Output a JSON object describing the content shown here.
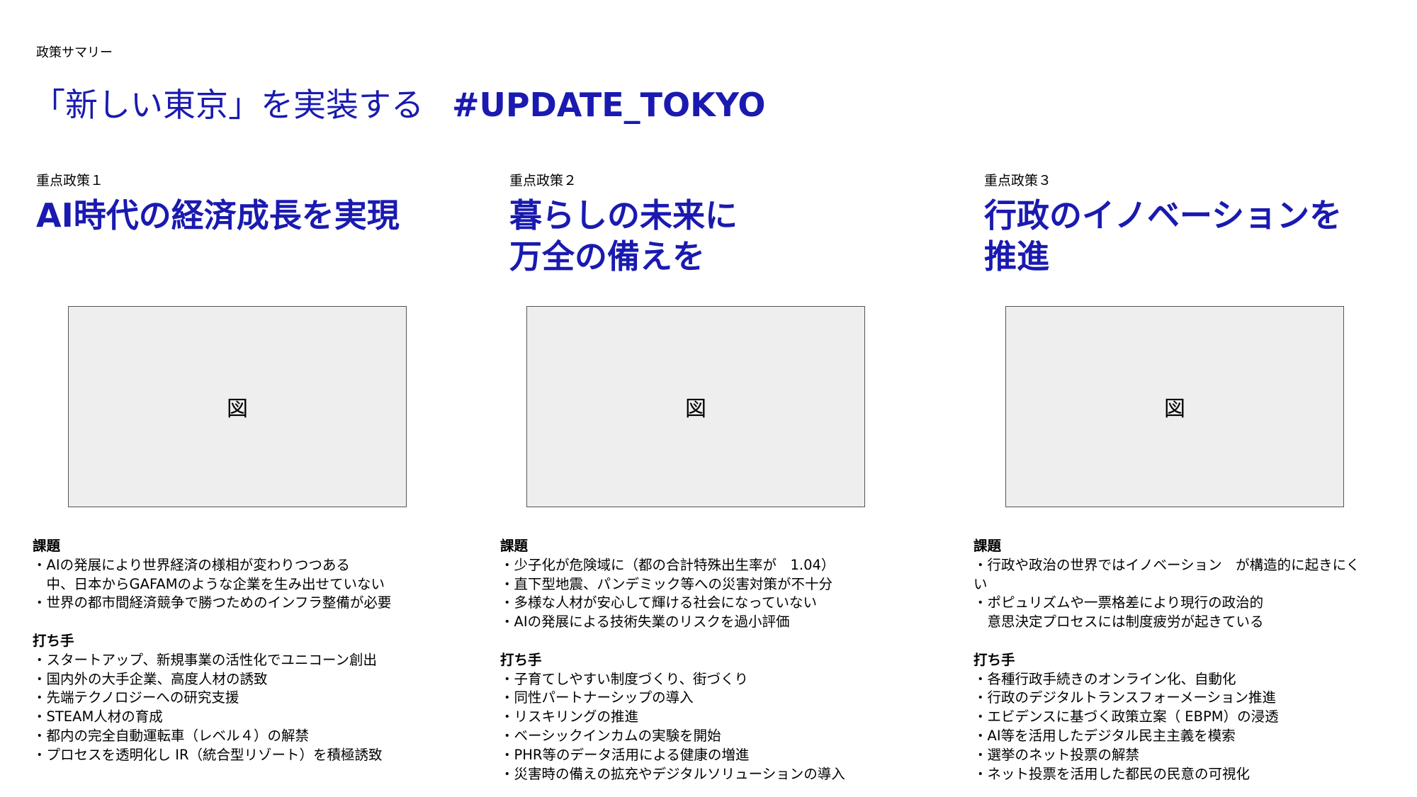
{
  "header": {
    "subtitle": "政策サマリー",
    "title": "「新しい東京」を実装する",
    "hashtag": "#UPDATE_TOKYO",
    "title_color": "#1a1ab0"
  },
  "figure_label": "図",
  "policies": [
    {
      "label": "重点政策１",
      "heading_lines": [
        "AI時代の経済成長を実現"
      ],
      "heading_strong": "AI",
      "heading_rest": "時代の経済成長を実現",
      "issues_title": "課題",
      "issues": [
        "・AIの発展により世界経済の様相が変わりつつある",
        "　中、日本からGAFAMのような企業を生み出せていない",
        "・世界の都市間経済競争で勝つためのインフラ整備が必要"
      ],
      "measures_title": "打ち手",
      "measures": [
        "・スタートアップ、新規事業の活性化でユニコーン創出",
        "・国内外の大手企業、高度人材の誘致",
        "・先端テクノロジーへの研究支援",
        "・STEAM人材の育成",
        "・都内の完全自動運転車（レベル４）の解禁",
        "・プロセスを透明化し IR（統合型リゾート）を積極誘致"
      ]
    },
    {
      "label": "重点政策２",
      "heading_lines": [
        "暮らしの未来に",
        "万全の備えを"
      ],
      "issues_title": "課題",
      "issues": [
        "・少子化が危険域に（都の合計特殊出生率が　1.04）",
        "・直下型地震、パンデミック等への災害対策が不十分",
        "・多様な人材が安心して輝ける社会になっていない",
        "・AIの発展による技術失業のリスクを過小評価"
      ],
      "measures_title": "打ち手",
      "measures": [
        "・子育てしやすい制度づくり、街づくり",
        "・同性パートナーシップの導入",
        "・リスキリングの推進",
        "・ベーシックインカムの実験を開始",
        "・PHR等のデータ活用による健康の増進",
        "・災害時の備えの拡充やデジタルソリューションの導入"
      ]
    },
    {
      "label": "重点政策３",
      "heading_lines": [
        "行政のイノベーションを",
        "推進"
      ],
      "issues_title": "課題",
      "issues": [
        "・行政や政治の世界ではイノベーション　が構造的に起きにく",
        "い",
        "・ポピュリズムや一票格差により現行の政治的",
        "　意思決定プロセスには制度疲労が起きている"
      ],
      "measures_title": "打ち手",
      "measures": [
        "・各種行政手続きのオンライン化、自動化",
        "・行政のデジタルトランスフォーメーション推進",
        "・エビデンスに基づく政策立案（ EBPM）の浸透",
        "・AI等を活用したデジタル民主主義を模索",
        "・選挙のネット投票の解禁",
        "・ネット投票を活用した都民の民意の可視化"
      ]
    }
  ]
}
